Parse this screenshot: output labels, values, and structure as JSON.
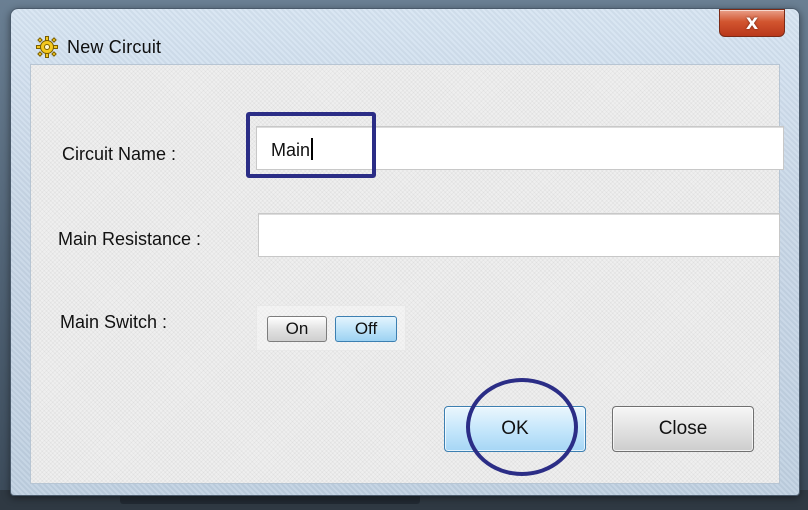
{
  "window": {
    "title": "New Circuit",
    "close_glyph": "X",
    "icon": "gear-icon"
  },
  "form": {
    "circuit_name_label": "Circuit Name :",
    "circuit_name_value": "Main",
    "main_resistance_label": "Main Resistance :",
    "main_resistance_value": "",
    "main_switch_label": "Main Switch :",
    "switch_on_label": "On",
    "switch_off_label": "Off",
    "switch_selected": "Off"
  },
  "buttons": {
    "ok_label": "OK",
    "close_label": "Close"
  },
  "colors": {
    "annotation": "#2b2d86",
    "close_button": "#d2552f",
    "selected_toggle": "#bfe4f9"
  }
}
